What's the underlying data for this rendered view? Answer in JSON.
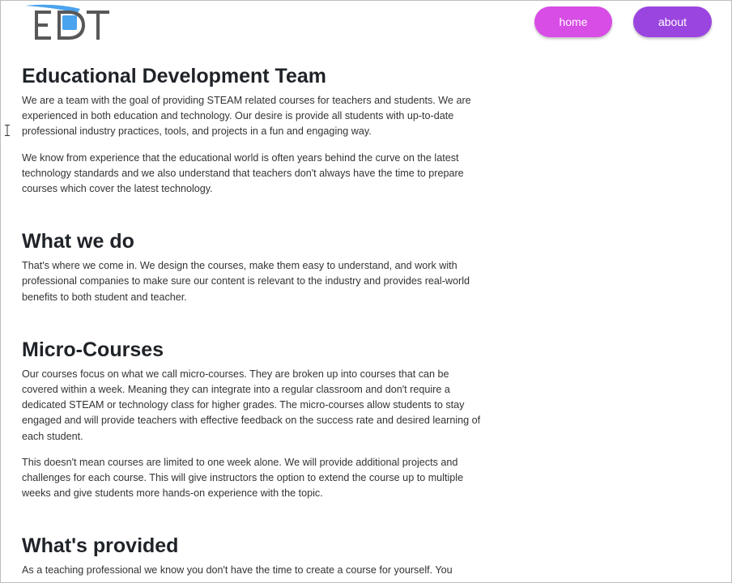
{
  "brand": {
    "logo_text": "EDT",
    "colors": {
      "letters": "#58585a",
      "accent": "#4aa3ee"
    }
  },
  "nav": {
    "home_label": "home",
    "about_label": "about",
    "colors": {
      "home": "#d84de6",
      "about": "#9b45e0"
    }
  },
  "sections": [
    {
      "title": "Educational Development Team",
      "paragraphs": [
        "We are a team with the goal of providing STEAM related courses for teachers and students. We are experienced in both education and technology. Our desire is provide all students with up-to-date professional industry practices, tools, and projects in a fun and engaging way.",
        "We know from experience that the educational world is often years behind the curve on the latest technology standards and we also understand that teachers don't always have the time to prepare courses which cover the latest technology."
      ]
    },
    {
      "title": "What we do",
      "paragraphs": [
        "That's where we come in. We design the courses, make them easy to understand, and work with professional companies to make sure our content is relevant to the industry and provides real-world benefits to both student and teacher."
      ]
    },
    {
      "title": "Micro-Courses",
      "paragraphs": [
        "Our courses focus on what we call micro-courses. They are broken up into courses that can be covered within a week. Meaning they can integrate into a regular classroom and don't require a dedicated STEAM or technology class for higher grades. The micro-courses allow students to stay engaged and will provide teachers with effective feedback on the success rate and desired learning of each student.",
        "This doesn't mean courses are limited to one week alone. We will provide additional projects and challenges for each course. This will give instructors the option to extend the course up to multiple weeks and give students more hands-on experience with the topic."
      ]
    },
    {
      "title": "What's provided",
      "paragraphs": [
        "As a teaching professional we know you don't have the time to create a course for yourself. You"
      ]
    }
  ]
}
